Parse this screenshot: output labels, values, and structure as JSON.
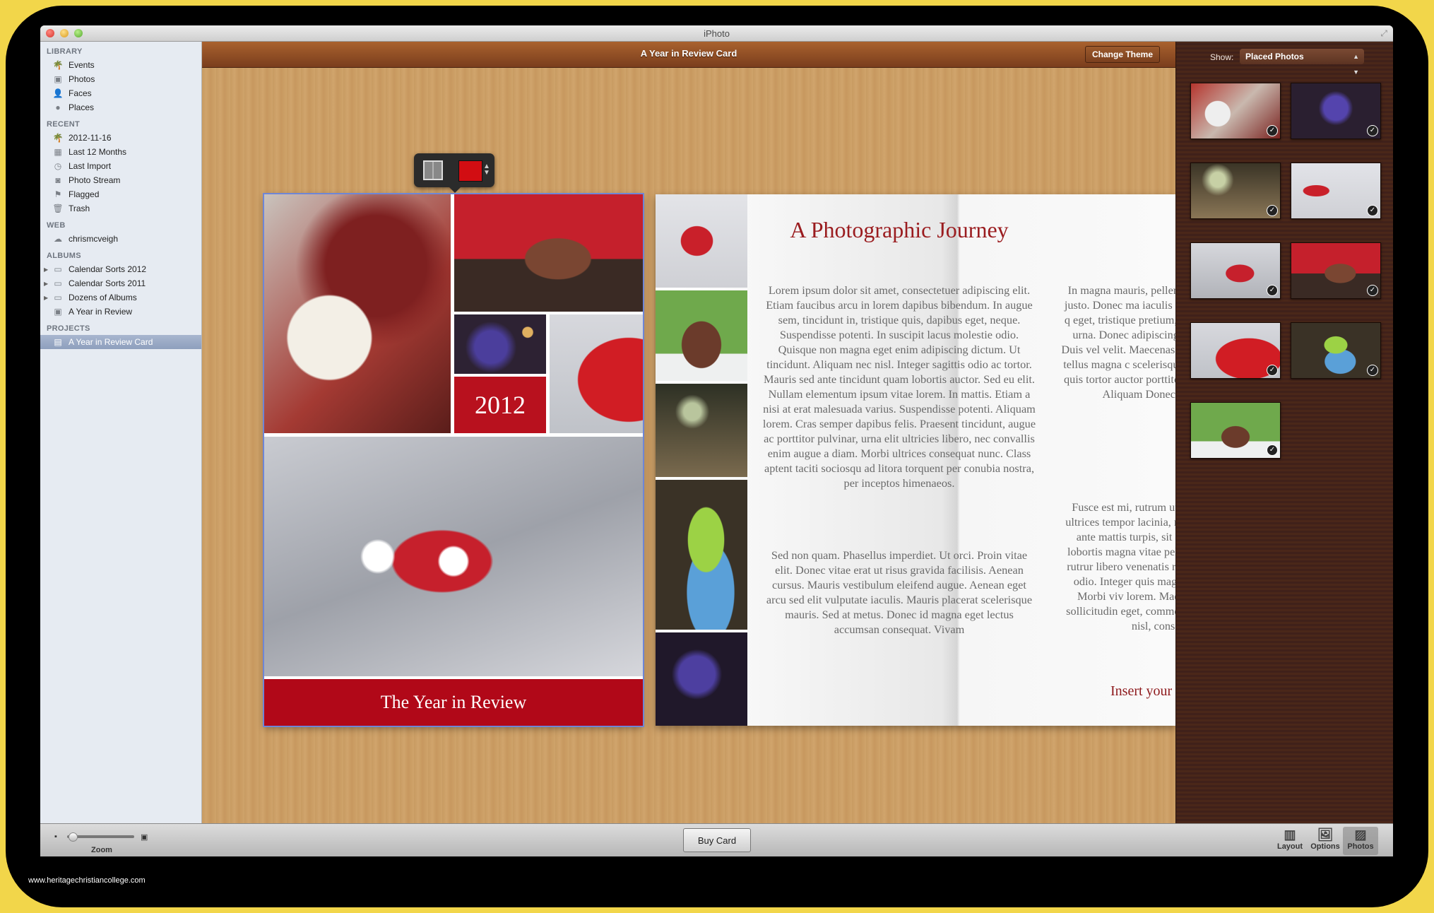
{
  "window": {
    "title": "iPhoto"
  },
  "sidebar": {
    "sections": [
      {
        "label": "LIBRARY",
        "items": [
          {
            "label": "Events",
            "icon": "palm-tree-icon"
          },
          {
            "label": "Photos",
            "icon": "photo-frame-icon"
          },
          {
            "label": "Faces",
            "icon": "person-icon"
          },
          {
            "label": "Places",
            "icon": "globe-icon"
          }
        ]
      },
      {
        "label": "RECENT",
        "items": [
          {
            "label": "2012-11-16",
            "icon": "palm-tree-icon"
          },
          {
            "label": "Last 12 Months",
            "icon": "calendar-icon"
          },
          {
            "label": "Last Import",
            "icon": "clock-icon"
          },
          {
            "label": "Photo Stream",
            "icon": "photo-stream-icon"
          },
          {
            "label": "Flagged",
            "icon": "flag-icon"
          },
          {
            "label": "Trash",
            "icon": "trash-icon"
          }
        ]
      },
      {
        "label": "WEB",
        "items": [
          {
            "label": "chrismcveigh",
            "icon": "cloud-icon"
          }
        ]
      },
      {
        "label": "ALBUMS",
        "items": [
          {
            "label": "Calendar Sorts 2012",
            "icon": "folder-icon"
          },
          {
            "label": "Calendar Sorts 2011",
            "icon": "folder-icon"
          },
          {
            "label": "Dozens of Albums",
            "icon": "folder-icon"
          },
          {
            "label": "A Year in Review",
            "icon": "album-icon"
          }
        ]
      },
      {
        "label": "PROJECTS",
        "items": [
          {
            "label": "A Year in Review Card",
            "icon": "card-icon",
            "selected": true
          }
        ]
      }
    ]
  },
  "project": {
    "title": "A Year in Review Card",
    "change_theme_label": "Change Theme",
    "accent_color": "#d20d12",
    "cover": {
      "year": "2012",
      "title": "The Year in Review"
    },
    "inside": {
      "heading": "A Photographic Journey",
      "left_paragraphs": [
        "Lorem ipsum dolor sit amet, consectetuer adipiscing elit. Etiam faucibus arcu in lorem dapibus bibendum. In augue sem, tincidunt in, tristique quis, dapibus eget, neque. Suspendisse potenti. In suscipit lacus molestie odio. Quisque non magna eget enim adipiscing dictum. Ut tincidunt. Aliquam nec nisl. Integer sagittis odio ac tortor. Mauris sed ante tincidunt quam lobortis auctor. Sed eu elit. Nullam elementum ipsum vitae lorem. In mattis. Etiam a nisi at erat malesuada varius. Suspendisse potenti. Aliquam lorem. Cras semper dapibus felis. Praesent tincidunt, augue ac porttitor pulvinar, urna elit ultricies libero, nec convallis enim augue a diam. Morbi ultrices consequat nunc. Class aptent taciti sociosqu ad litora torquent per conubia nostra, per inceptos himenaeos.",
        "Sed non quam. Phasellus imperdiet. Ut orci. Proin vitae elit. Donec vitae erat ut risus gravida facilisis. Aenean cursus. Mauris vestibulum eleifend augue. Aenean eget arcu sed elit vulputate iaculis. Mauris placerat scelerisque mauris. Sed at metus. Donec id magna eget lectus accumsan consequat. Vivam"
      ],
      "right_paragraphs": [
        "In magna mauris, pellentesqu venenatis eu, justo. Donec ma iaculis mi et metus. Sed dui q eget, tristique pretium, aliqu Phasellus non urna. Donec adipiscing libero. Ut venena Duis vel velit. Maecenas blanc feugiat ornare, tellus magna c scelerisque tellus ante et mass quis tortor auctor porttitor. libero eget lectus. Aliquam Donec nec mi. Cra",
        "Fusce est mi, rutrum ut, tempo at, erat. In ultrices tempor lacinia, massa eget fermentu ante mattis turpis, sit amet ten diam. Ut lobortis magna vitae pellentesque, massa at rutrur libero venenatis risus, sed euis mattis odio. Integer quis mag aliquam volutpat. Morbi viv lorem. Maecenas nulla leo, i sollicitudin eget, commodo v arcu. Sed eros nisl, consectetu"
      ],
      "insert_message": "Insert your messag"
    }
  },
  "photos_panel": {
    "show_label": "Show:",
    "show_value": "Placed Photos",
    "thumbnails": [
      {
        "name": "santa-ornament",
        "placed": true
      },
      {
        "name": "purple-bow",
        "placed": true
      },
      {
        "name": "green-ribbon",
        "placed": true
      },
      {
        "name": "red-ornament-ribbon",
        "placed": true
      },
      {
        "name": "red-ornament-silver",
        "placed": true
      },
      {
        "name": "lego-turkey",
        "placed": true
      },
      {
        "name": "red-lego-closeup",
        "placed": true
      },
      {
        "name": "ornaments-basket",
        "placed": true
      },
      {
        "name": "gingerbread-house",
        "placed": true
      }
    ]
  },
  "bottombar": {
    "zoom_label": "Zoom",
    "zoom_level": 0.05,
    "buy_card_label": "Buy Card",
    "modes": [
      {
        "label": "Layout",
        "icon": "layout-icon",
        "active": false
      },
      {
        "label": "Options",
        "icon": "options-icon",
        "active": false
      },
      {
        "label": "Photos",
        "icon": "photos-icon",
        "active": true
      }
    ]
  },
  "credit": "www.heritagechristiancollege.com"
}
